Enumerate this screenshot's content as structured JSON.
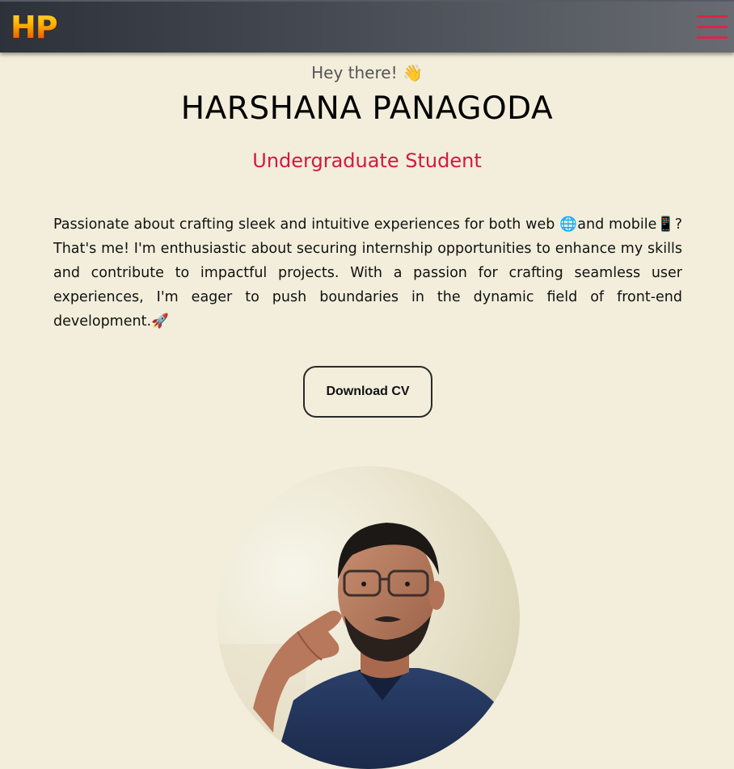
{
  "navbar": {
    "logo_text": "HP",
    "menu_icon": "hamburger-menu-icon"
  },
  "hero": {
    "greeting": "Hey there!",
    "greeting_emoji": "👋",
    "name": "HARSHANA PANAGODA",
    "role": "Undergraduate Student",
    "bio_parts": {
      "p1": "Passionate about crafting sleek and intuitive experiences for both web ",
      "globe_emoji": "🌐",
      "p2": "and mobile",
      "phone_emoji": "📱",
      "p3": "? That's me! I'm enthusiastic about securing internship opportunities to enhance my skills and contribute to impactful projects. With a passion for crafting seamless user experiences, I'm eager to push boundaries in the dynamic field of front-end development.",
      "rocket_emoji": "🚀"
    },
    "cv_button_label": "Download CV"
  },
  "colors": {
    "background": "#f2eedb",
    "accent": "#d6173f",
    "navbar_start": "#2d3139",
    "navbar_end": "#686c72"
  },
  "profile_photo": {
    "shape": "circle"
  }
}
